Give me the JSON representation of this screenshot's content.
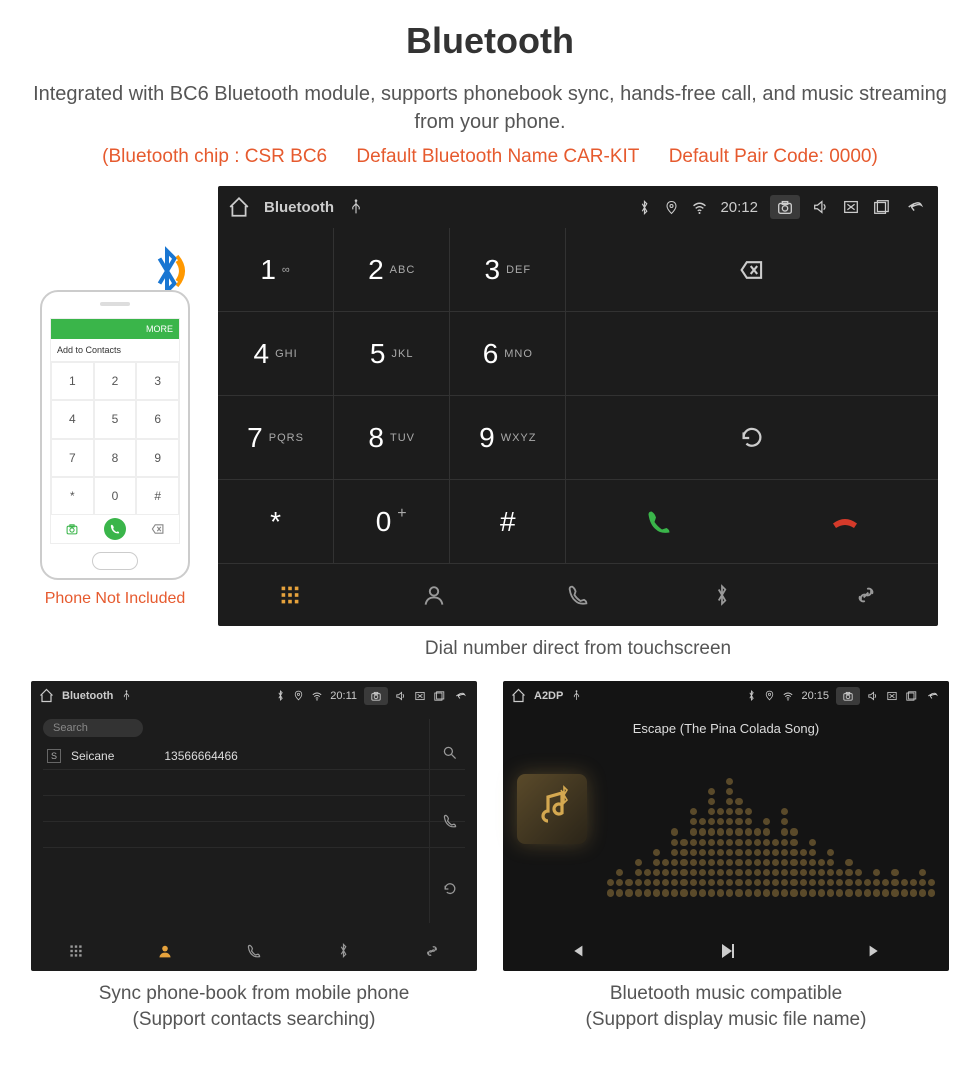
{
  "title": "Bluetooth",
  "subtitle": "Integrated with BC6 Bluetooth module, supports phonebook sync, hands-free call, and music streaming from your phone.",
  "info": {
    "chip": "(Bluetooth chip : CSR BC6",
    "name": "Default Bluetooth Name CAR-KIT",
    "code": "Default Pair Code: 0000)"
  },
  "phone": {
    "top_bar_more": "MORE",
    "add_contacts": "Add to Contacts",
    "pad": [
      "1",
      "2",
      "3",
      "4",
      "5",
      "6",
      "7",
      "8",
      "9",
      "*",
      "0",
      "#"
    ],
    "caption": "Phone Not Included"
  },
  "hu_large": {
    "app_title": "Bluetooth",
    "time": "20:12",
    "keys": [
      {
        "d": "1",
        "s": "∞"
      },
      {
        "d": "2",
        "s": "ABC"
      },
      {
        "d": "3",
        "s": "DEF"
      },
      {
        "d": "4",
        "s": "GHI"
      },
      {
        "d": "5",
        "s": "JKL"
      },
      {
        "d": "6",
        "s": "MNO"
      },
      {
        "d": "7",
        "s": "PQRS"
      },
      {
        "d": "8",
        "s": "TUV"
      },
      {
        "d": "9",
        "s": "WXYZ"
      },
      {
        "d": "*",
        "s": ""
      },
      {
        "d": "0",
        "s": "+"
      },
      {
        "d": "#",
        "s": ""
      }
    ],
    "caption": "Dial number direct from touchscreen"
  },
  "hu_contacts": {
    "app_title": "Bluetooth",
    "time": "20:11",
    "search": "Search",
    "contact_badge": "S",
    "contact_name": "Seicane",
    "contact_number": "13566664466",
    "caption_l1": "Sync phone-book from mobile phone",
    "caption_l2": "(Support contacts searching)"
  },
  "hu_music": {
    "app_title": "A2DP",
    "time": "20:15",
    "song": "Escape (The Pina Colada Song)",
    "caption_l1": "Bluetooth music compatible",
    "caption_l2": "(Support display music file name)"
  }
}
